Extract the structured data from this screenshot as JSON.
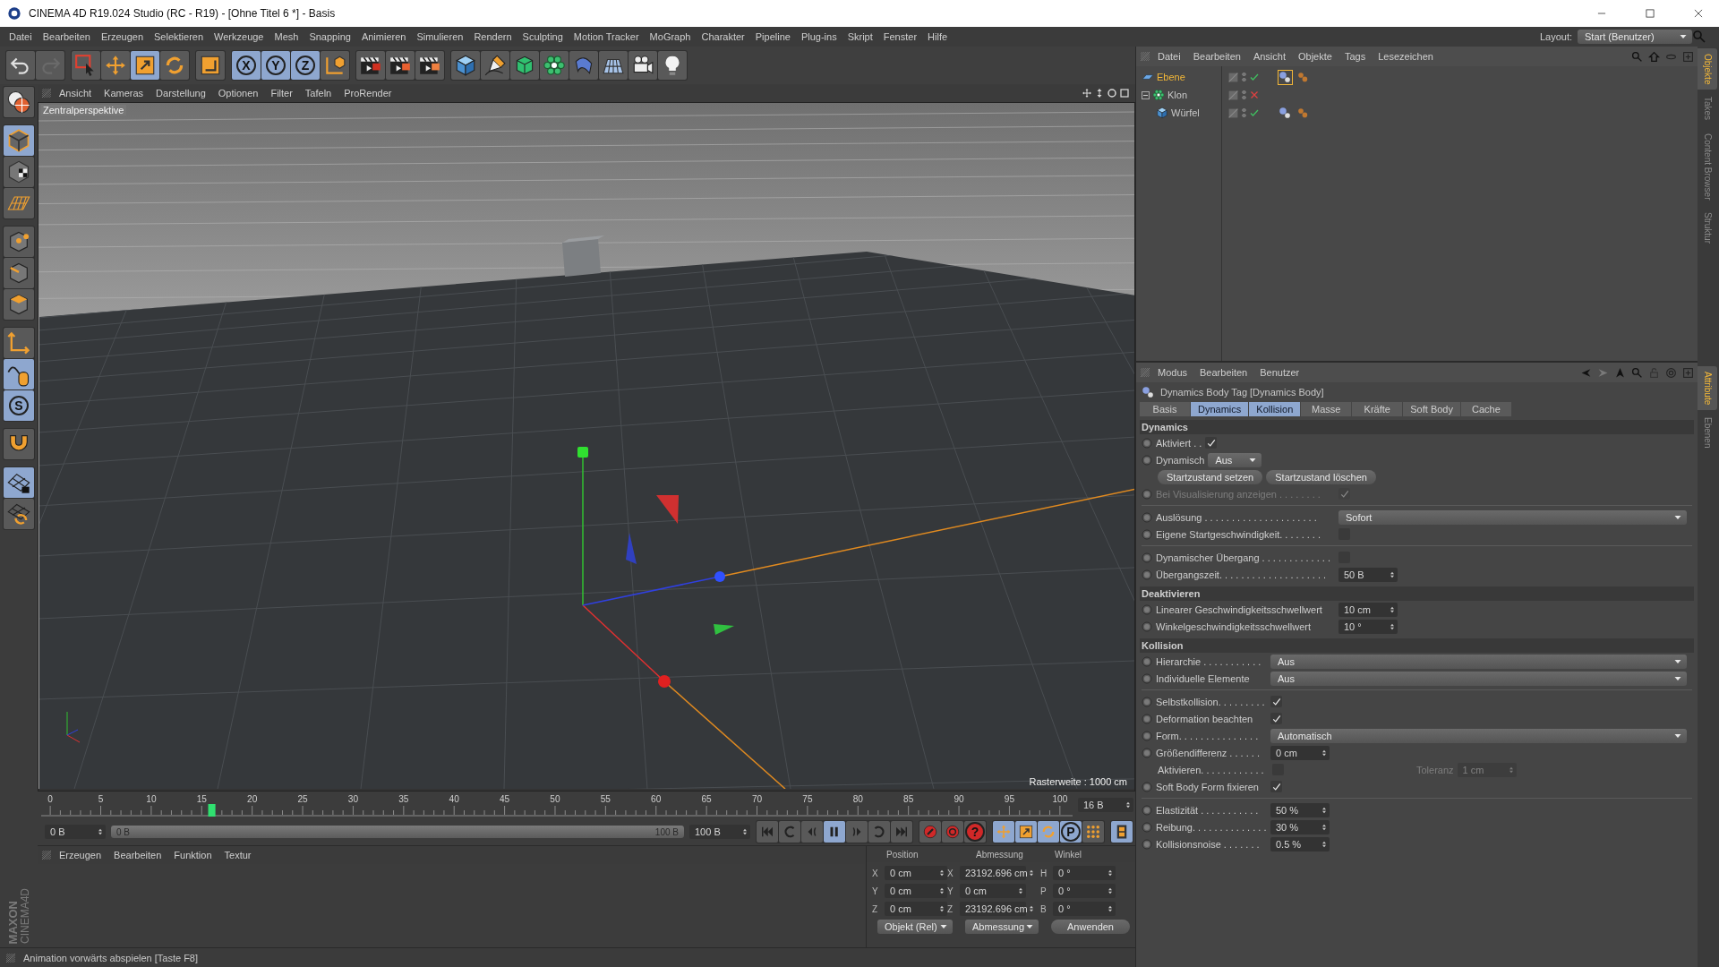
{
  "window": {
    "title": "CINEMA 4D R19.024 Studio (RC - R19) - [Ohne Titel 6 *] - Basis"
  },
  "menu": [
    "Datei",
    "Bearbeiten",
    "Erzeugen",
    "Selektieren",
    "Werkzeuge",
    "Mesh",
    "Snapping",
    "Animieren",
    "Simulieren",
    "Rendern",
    "Sculpting",
    "Motion Tracker",
    "MoGraph",
    "Charakter",
    "Pipeline",
    "Plug-ins",
    "Skript",
    "Fenster",
    "Hilfe"
  ],
  "layout": {
    "label": "Layout:",
    "value": "Start (Benutzer)"
  },
  "toolbar": [
    {
      "items": [
        {
          "kind": "undo",
          "selected": false
        },
        {
          "kind": "redo",
          "selected": false
        }
      ]
    },
    {
      "items": [
        {
          "kind": "select",
          "selected": false
        },
        {
          "kind": "move",
          "selected": false
        },
        {
          "kind": "scale",
          "selected": true
        },
        {
          "kind": "rotate",
          "selected": false
        }
      ]
    },
    {
      "items": [
        {
          "kind": "transform",
          "selected": false
        }
      ]
    },
    {
      "items": [
        {
          "kind": "axis",
          "label": "X",
          "selected": true
        },
        {
          "kind": "axis",
          "label": "Y",
          "selected": true
        },
        {
          "kind": "axis",
          "label": "Z",
          "selected": true
        },
        {
          "kind": "coord",
          "selected": false
        }
      ]
    },
    {
      "items": [
        {
          "kind": "render-view",
          "selected": false
        },
        {
          "kind": "render",
          "selected": false
        },
        {
          "kind": "render-settings",
          "selected": false
        }
      ]
    },
    {
      "items": [
        {
          "kind": "cube",
          "selected": false
        },
        {
          "kind": "pen",
          "selected": false
        },
        {
          "kind": "subdiv",
          "selected": false
        },
        {
          "kind": "cloner",
          "selected": false
        },
        {
          "kind": "deformer",
          "selected": false
        },
        {
          "kind": "floor",
          "selected": false
        },
        {
          "kind": "camera",
          "selected": false
        },
        {
          "kind": "light",
          "selected": false
        }
      ]
    }
  ],
  "tools": [
    {
      "items": [
        {
          "kind": "model",
          "selected": false
        }
      ]
    },
    {
      "items": [
        {
          "kind": "object",
          "selected": true
        },
        {
          "kind": "texture",
          "selected": false
        },
        {
          "kind": "workplane",
          "selected": false
        }
      ]
    },
    {
      "items": [
        {
          "kind": "points",
          "selected": false
        },
        {
          "kind": "edges",
          "selected": false
        },
        {
          "kind": "polygons",
          "selected": false
        }
      ]
    },
    {
      "items": [
        {
          "kind": "axis",
          "selected": false
        },
        {
          "kind": "tweak",
          "selected": true
        },
        {
          "kind": "solo",
          "label": "S",
          "selected": true
        }
      ]
    },
    {
      "items": [
        {
          "kind": "snap",
          "selected": false
        }
      ]
    },
    {
      "items": [
        {
          "kind": "gridlock",
          "selected": true
        },
        {
          "kind": "gridcycle",
          "selected": false
        }
      ]
    }
  ],
  "viewport": {
    "menu": [
      "Ansicht",
      "Kameras",
      "Darstellung",
      "Optionen",
      "Filter",
      "Tafeln",
      "ProRender"
    ],
    "camera": "Zentralperspektive",
    "grid_info": "Rasterweite : 1000 cm"
  },
  "timeline": {
    "ticks": [
      "0",
      "5",
      "10",
      "15",
      "20",
      "25",
      "30",
      "35",
      "40",
      "45",
      "50",
      "55",
      "60",
      "65",
      "70",
      "75",
      "80",
      "85",
      "90",
      "95",
      "100"
    ],
    "level": 0.16,
    "frame": "16 B"
  },
  "range": {
    "start": "0 B",
    "slider_start": "0 B",
    "slider_end": "100 B",
    "end": "100 B",
    "level": 1
  },
  "playback": [
    {
      "items": [
        {
          "kind": "first",
          "selected": false
        },
        {
          "kind": "loopback",
          "selected": false
        },
        {
          "kind": "prev",
          "selected": false
        },
        {
          "kind": "play",
          "selected": true
        },
        {
          "kind": "next",
          "selected": false
        },
        {
          "kind": "loop",
          "selected": false
        },
        {
          "kind": "last",
          "selected": false
        }
      ]
    },
    {
      "items": [
        {
          "kind": "keyrec",
          "selected": false
        },
        {
          "kind": "autokey",
          "selected": false
        },
        {
          "kind": "help",
          "label": "?",
          "selected": false
        }
      ]
    },
    {
      "items": [
        {
          "kind": "move",
          "selected": true
        },
        {
          "kind": "scale",
          "selected": true
        },
        {
          "kind": "rotate",
          "selected": true
        },
        {
          "kind": "param",
          "label": "P",
          "selected": true
        },
        {
          "kind": "dots",
          "selected": false
        }
      ]
    },
    {
      "items": [
        {
          "kind": "film",
          "selected": true
        }
      ]
    }
  ],
  "materials": {
    "menu": [
      "Erzeugen",
      "Bearbeiten",
      "Funktion",
      "Textur"
    ]
  },
  "coordinates": {
    "headers": [
      "Position",
      "Abmessung",
      "Winkel"
    ],
    "rows": [
      {
        "axis": "X",
        "position": "0 cm",
        "size_axis": "X",
        "size": "23192.696 cm",
        "angle_axis": "H",
        "angle": "0 °"
      },
      {
        "axis": "Y",
        "position": "0 cm",
        "size_axis": "Y",
        "size": "0 cm",
        "angle_axis": "P",
        "angle": "0 °"
      },
      {
        "axis": "Z",
        "position": "0 cm",
        "size_axis": "Z",
        "size": "23192.696 cm",
        "angle_axis": "B",
        "angle": "0 °"
      }
    ],
    "mode": "Objekt (Rel)",
    "size_mode": "Abmessung",
    "apply": "Anwenden"
  },
  "logo": {
    "brand": "MAXON",
    "product": "CINEMA4D"
  },
  "status_bar": "Animation vorwärts abspielen [Taste F8]",
  "objects": {
    "menu": [
      "Datei",
      "Bearbeiten",
      "Ansicht",
      "Objekte",
      "Tags",
      "Lesezeichen"
    ],
    "tree": [
      {
        "name": "Ebene",
        "kind": "plane",
        "selected": true,
        "enabled": true,
        "expanded": false,
        "tags": [
          {
            "kind": "dynamics",
            "selected": true
          },
          {
            "kind": "body",
            "selected": false
          }
        ]
      },
      {
        "name": "Klon",
        "kind": "cloner",
        "selected": false,
        "enabled": false,
        "expanded": true,
        "children": [
          {
            "name": "Würfel",
            "kind": "cube",
            "selected": false,
            "enabled": true,
            "expanded": false,
            "tags": [
              {
                "kind": "dynamics",
                "selected": false
              },
              {
                "kind": "body",
                "selected": false
              }
            ]
          }
        ]
      }
    ]
  },
  "side_tabs_top": [
    {
      "label": "Objekte",
      "selected": true
    },
    {
      "label": "Takes",
      "selected": false
    },
    {
      "label": "Content Browser",
      "selected": false
    },
    {
      "label": "Struktur",
      "selected": false
    }
  ],
  "side_tabs_bottom": [
    {
      "label": "Attribute",
      "selected": true
    },
    {
      "label": "Ebenen",
      "selected": false
    }
  ],
  "attributes": {
    "menu": [
      "Modus",
      "Bearbeiten",
      "Benutzer"
    ],
    "title": "Dynamics Body Tag [Dynamics Body]",
    "tabs": [
      {
        "label": "Basis",
        "selected": false
      },
      {
        "label": "Dynamics",
        "selected": true
      },
      {
        "label": "Kollision",
        "selected": true
      },
      {
        "label": "Masse",
        "selected": false
      },
      {
        "label": "Kräfte",
        "selected": false
      },
      {
        "label": "Soft Body",
        "selected": false
      },
      {
        "label": "Cache",
        "selected": false
      }
    ],
    "sections": [
      {
        "title": "Dynamics",
        "rows": [
          {
            "kind": "compact_check",
            "label": "Aktiviert . .",
            "checked": true,
            "disabled": false
          },
          {
            "kind": "compact_dropdown",
            "label": "Dynamisch",
            "value": "Aus"
          },
          {
            "kind": "buttons",
            "buttons": [
              "Startzustand setzen",
              "Startzustand löschen"
            ]
          },
          {
            "kind": "check",
            "label": "Bei Visualisierung anzeigen . . . . . . . .",
            "checked": true,
            "disabled": true
          },
          {
            "kind": "divider"
          },
          {
            "kind": "dropdown",
            "label": "Auslösung . . . . . . . . . . . . . . . . . . . . .",
            "value": "Sofort"
          },
          {
            "kind": "check",
            "label": "Eigene Startgeschwindigkeit. . . . . . . .",
            "checked": false,
            "disabled": false
          },
          {
            "kind": "divider"
          },
          {
            "kind": "check",
            "label": "Dynamischer Übergang . . . . . . . . . . . . .",
            "checked": false,
            "disabled": false
          },
          {
            "kind": "field",
            "label": "Übergangszeit. . . . . . . . . . . . . . . . . . . .",
            "value": "50 B"
          }
        ]
      },
      {
        "title": "Deaktivieren",
        "rows": [
          {
            "kind": "field",
            "label": "Linearer Geschwindigkeitsschwellwert",
            "value": "10 cm"
          },
          {
            "kind": "field",
            "label": "Winkelgeschwindigkeitsschwellwert",
            "value": "10 °"
          }
        ]
      },
      {
        "title": "Kollision",
        "rows": [
          {
            "kind": "dropdown",
            "label": "Hierarchie . . . . . . . . . . .",
            "value": "Aus"
          },
          {
            "kind": "dropdown",
            "label": "Individuelle Elemente",
            "value": "Aus"
          },
          {
            "kind": "divider"
          },
          {
            "kind": "check",
            "label": "Selbstkollision. . . . . . . . .",
            "checked": true,
            "disabled": false
          },
          {
            "kind": "check",
            "label": "Deformation beachten",
            "checked": true,
            "disabled": false
          },
          {
            "kind": "dropdown",
            "label": "Form. . . . . . . . . . . . . . .",
            "value": "Automatisch"
          },
          {
            "kind": "field",
            "label": "Größendifferenz . . . . . .",
            "value": "0 cm"
          },
          {
            "kind": "toggle_field",
            "label": "Aktivieren. . . . . . . . . . . .",
            "checked": false,
            "disabled": false,
            "extra_label": "Toleranz",
            "extra_value": "1 cm",
            "extra_disabled": true
          },
          {
            "kind": "check",
            "label": "Soft Body Form fixieren",
            "checked": true,
            "disabled": false
          },
          {
            "kind": "divider"
          },
          {
            "kind": "field",
            "label": "Elastizität . . . . . . . . . . .",
            "value": "50 %"
          },
          {
            "kind": "field",
            "label": "Reibung. . . . . . . . . . . . . .",
            "value": "30 %"
          },
          {
            "kind": "field",
            "label": "Kollisionsnoise . . . . . . .",
            "value": "0.5 %"
          }
        ]
      }
    ]
  }
}
